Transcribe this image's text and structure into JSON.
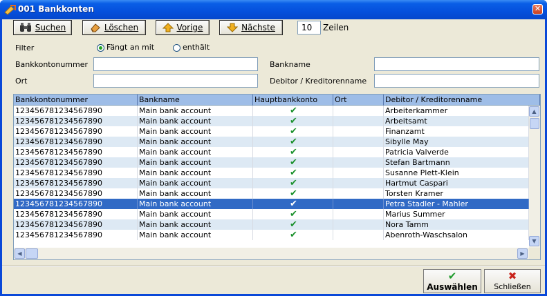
{
  "window": {
    "title": "001 Bankkonten",
    "close_glyph": "✕"
  },
  "toolbar": {
    "search_label": "Suchen",
    "delete_label": "Löschen",
    "previous_label": "Vorige",
    "next_label": "Nächste",
    "rows_value": "10",
    "rows_label": "Zeilen"
  },
  "filter": {
    "label": "Filter",
    "mode_starts_with": "Fängt an mit",
    "mode_contains": "enthält",
    "selected_mode": "starts_with",
    "fields": {
      "account_number_label": "Bankkontonummer",
      "account_number_value": "",
      "bank_name_label": "Bankname",
      "bank_name_value": "",
      "city_label": "Ort",
      "city_value": "",
      "debtor_label": "Debitor / Kreditorenname",
      "debtor_value": ""
    }
  },
  "table": {
    "columns": [
      "Bankkontonummer",
      "Bankname",
      "Hauptbankkonto",
      "Ort",
      "Debitor / Kreditorenname"
    ],
    "check_glyph": "✔",
    "rows": [
      {
        "account": "123456781234567890",
        "bank": "Main bank account",
        "main": true,
        "city": "",
        "name": "Arbeiterkammer"
      },
      {
        "account": "123456781234567890",
        "bank": "Main bank account",
        "main": true,
        "city": "",
        "name": "Arbeitsamt"
      },
      {
        "account": "123456781234567890",
        "bank": "Main bank account",
        "main": true,
        "city": "",
        "name": "Finanzamt"
      },
      {
        "account": "123456781234567890",
        "bank": "Main bank account",
        "main": true,
        "city": "",
        "name": "Sibylle May"
      },
      {
        "account": "123456781234567890",
        "bank": "Main bank account",
        "main": true,
        "city": "",
        "name": "Patricia Valverde"
      },
      {
        "account": "123456781234567890",
        "bank": "Main bank account",
        "main": true,
        "city": "",
        "name": "Stefan Bartmann"
      },
      {
        "account": "123456781234567890",
        "bank": "Main bank account",
        "main": true,
        "city": "",
        "name": "Susanne Plett-Klein"
      },
      {
        "account": "123456781234567890",
        "bank": "Main bank account",
        "main": true,
        "city": "",
        "name": "Hartmut Caspari"
      },
      {
        "account": "123456781234567890",
        "bank": "Main bank account",
        "main": true,
        "city": "",
        "name": "Torsten Kramer"
      },
      {
        "account": "123456781234567890",
        "bank": "Main bank account",
        "main": true,
        "city": "",
        "name": "Petra Stadler - Mahler"
      },
      {
        "account": "123456781234567890",
        "bank": "Main bank account",
        "main": true,
        "city": "",
        "name": "Marius Summer"
      },
      {
        "account": "123456781234567890",
        "bank": "Main bank account",
        "main": true,
        "city": "",
        "name": "Nora Tamm"
      },
      {
        "account": "123456781234567890",
        "bank": "Main bank account",
        "main": true,
        "city": "",
        "name": "Abenroth-Waschsalon"
      }
    ],
    "selected_row": 9
  },
  "footer": {
    "select_label": "Auswählen",
    "select_icon": "check-icon",
    "close_label": "Schließen",
    "close_icon": "cross-icon"
  },
  "colors": {
    "titlebar": "#0a5ee6",
    "header": "#9ebde7",
    "row_alt": "#dde9f4",
    "selection": "#316ac5",
    "checkmark": "#19902b"
  }
}
